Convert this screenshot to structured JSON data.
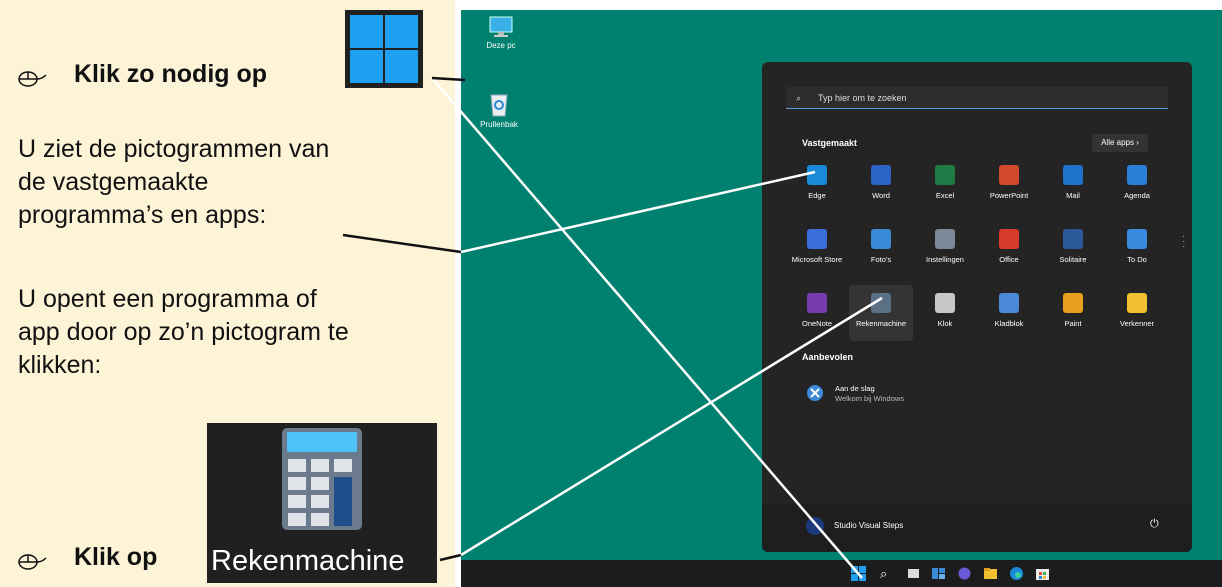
{
  "instructions": {
    "step1": "Klik zo nodig op",
    "para1": [
      "U ziet de pictogrammen van",
      "de vastgemaakte",
      "programma’s en apps:"
    ],
    "para2": [
      "U opent een programma of",
      "app door op zo’n pictogram te",
      "klikken:"
    ],
    "step2": "Klik op",
    "calc_label": "Rekenmachine"
  },
  "desktop": {
    "icons": [
      {
        "label": "Deze pc",
        "icon": "monitor-icon"
      },
      {
        "label": "Prullenbak",
        "icon": "recycle-bin-icon"
      }
    ]
  },
  "start_menu": {
    "search_placeholder": "Typ hier om te zoeken",
    "pinned_title": "Vastgemaakt",
    "all_apps": "Alle apps  ›",
    "pinned": [
      {
        "label": "Edge",
        "color": "#1a8ad8"
      },
      {
        "label": "Word",
        "color": "#2b63c7"
      },
      {
        "label": "Excel",
        "color": "#1f7a45"
      },
      {
        "label": "PowerPoint",
        "color": "#d24a2b"
      },
      {
        "label": "Mail",
        "color": "#1e73c9"
      },
      {
        "label": "Agenda",
        "color": "#2a7fd8"
      },
      {
        "label": "Microsoft Store",
        "color": "#3a6ed8"
      },
      {
        "label": "Foto's",
        "color": "#3a8ad8"
      },
      {
        "label": "Instellingen",
        "color": "#7a8898"
      },
      {
        "label": "Office",
        "color": "#d83b2b"
      },
      {
        "label": "Solitaire",
        "color": "#2a5a9a"
      },
      {
        "label": "To Do",
        "color": "#3a8ae0"
      },
      {
        "label": "OneNote",
        "color": "#7a3ab0"
      },
      {
        "label": "Rekenmachine",
        "color": "#5b6f85"
      },
      {
        "label": "Klok",
        "color": "#c8c8c8"
      },
      {
        "label": "Kladblok",
        "color": "#4a8ad8"
      },
      {
        "label": "Paint",
        "color": "#e8a020"
      },
      {
        "label": "Verkenner",
        "color": "#f0c030"
      }
    ],
    "recommended_title": "Aanbevolen",
    "recommended": {
      "title": "Aan de slag",
      "subtitle": "Welkom bij Windows"
    },
    "user": "Studio Visual Steps"
  }
}
